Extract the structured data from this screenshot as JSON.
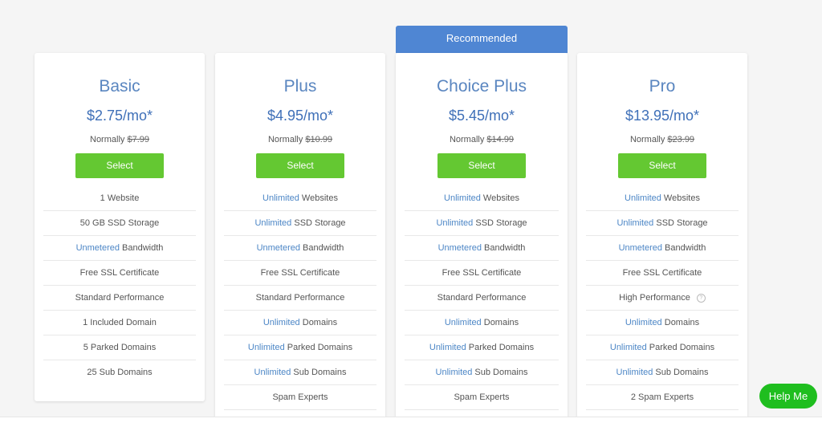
{
  "recommended_label": "Recommended",
  "plans": [
    {
      "name": "Basic",
      "price": "$2.75/mo*",
      "normally_label": "Normally",
      "normal_price": "$7.99",
      "select_label": "Select",
      "features": [
        {
          "hl": "",
          "text": "1 Website"
        },
        {
          "hl": "",
          "text": "50 GB SSD Storage"
        },
        {
          "hl": "Unmetered",
          "text": " Bandwidth"
        },
        {
          "hl": "",
          "text": "Free SSL Certificate"
        },
        {
          "hl": "",
          "text": "Standard Performance"
        },
        {
          "hl": "",
          "text": "1 Included Domain"
        },
        {
          "hl": "",
          "text": "5 Parked Domains"
        },
        {
          "hl": "",
          "text": "25 Sub Domains"
        }
      ]
    },
    {
      "name": "Plus",
      "price": "$4.95/mo*",
      "normally_label": "Normally",
      "normal_price": "$10.99",
      "select_label": "Select",
      "features": [
        {
          "hl": "Unlimited",
          "text": " Websites"
        },
        {
          "hl": "Unlimited",
          "text": " SSD Storage"
        },
        {
          "hl": "Unmetered",
          "text": " Bandwidth"
        },
        {
          "hl": "",
          "text": "Free SSL Certificate"
        },
        {
          "hl": "",
          "text": "Standard Performance"
        },
        {
          "hl": "Unlimited",
          "text": " Domains"
        },
        {
          "hl": "Unlimited",
          "text": " Parked Domains"
        },
        {
          "hl": "Unlimited",
          "text": " Sub Domains"
        },
        {
          "hl": "",
          "text": "Spam Experts"
        }
      ]
    },
    {
      "name": "Choice Plus",
      "price": "$5.45/mo*",
      "normally_label": "Normally",
      "normal_price": "$14.99",
      "select_label": "Select",
      "features": [
        {
          "hl": "Unlimited",
          "text": " Websites"
        },
        {
          "hl": "Unlimited",
          "text": " SSD Storage"
        },
        {
          "hl": "Unmetered",
          "text": " Bandwidth"
        },
        {
          "hl": "",
          "text": "Free SSL Certificate"
        },
        {
          "hl": "",
          "text": "Standard Performance"
        },
        {
          "hl": "Unlimited",
          "text": " Domains"
        },
        {
          "hl": "Unlimited",
          "text": " Parked Domains"
        },
        {
          "hl": "Unlimited",
          "text": " Sub Domains"
        },
        {
          "hl": "",
          "text": "Spam Experts"
        }
      ]
    },
    {
      "name": "Pro",
      "price": "$13.95/mo*",
      "normally_label": "Normally",
      "normal_price": "$23.99",
      "select_label": "Select",
      "features": [
        {
          "hl": "Unlimited",
          "text": " Websites"
        },
        {
          "hl": "Unlimited",
          "text": " SSD Storage"
        },
        {
          "hl": "Unmetered",
          "text": " Bandwidth"
        },
        {
          "hl": "",
          "text": "Free SSL Certificate"
        },
        {
          "hl": "",
          "text": "High Performance",
          "help": "?"
        },
        {
          "hl": "Unlimited",
          "text": " Domains"
        },
        {
          "hl": "Unlimited",
          "text": " Parked Domains"
        },
        {
          "hl": "Unlimited",
          "text": " Sub Domains"
        },
        {
          "hl": "",
          "text": "2 Spam Experts"
        }
      ]
    }
  ],
  "help_button_label": "Help Me",
  "colors": {
    "accent_blue": "#4f86d3",
    "select_green": "#64c832",
    "help_green": "#1fbe1f"
  }
}
